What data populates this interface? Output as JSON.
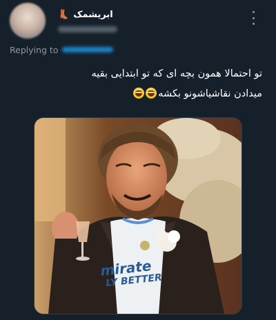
{
  "tweet": {
    "author": {
      "display_name": "ابریشمک",
      "badge_icon": "boot-emoji-icon"
    },
    "more_icon": "more-options-icon",
    "reply_label": "Replying to",
    "text_lines": [
      "تو احتمالا همون بچه ای که تو ابتدایی بقیه",
      "میدادن نقاشیاشونو بکشه"
    ],
    "emoji": [
      "grinning-squinting-face-icon",
      "grinning-squinting-face-icon"
    ],
    "media": {
      "type": "meme-photo",
      "shirt_text_line1": "mirate",
      "shirt_text_line2": "LY BETTER"
    }
  },
  "colors": {
    "background": "#15202b",
    "text": "#ffffff",
    "muted": "#8b98a5",
    "link": "#1d9bf0"
  }
}
